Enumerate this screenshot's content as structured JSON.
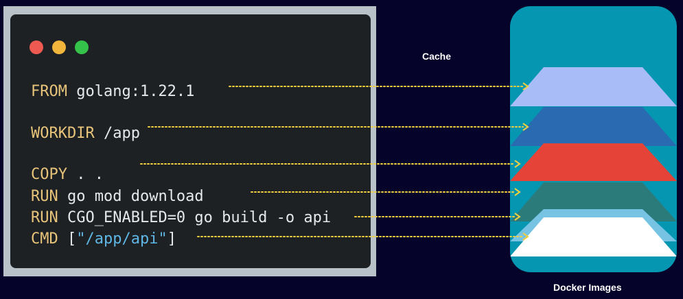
{
  "terminal": {
    "window_dots": [
      {
        "name": "close",
        "color": "#ee5a52"
      },
      {
        "name": "minimize",
        "color": "#f3b63d"
      },
      {
        "name": "maximize",
        "color": "#35c24a"
      }
    ],
    "lines": [
      {
        "keyword": "FROM",
        "text": " golang:1.22.1",
        "string": "",
        "suffix": ""
      },
      {
        "keyword": "WORKDIR",
        "text": " /app",
        "string": "",
        "suffix": ""
      },
      {
        "keyword": "COPY",
        "text": " . .",
        "string": "",
        "suffix": ""
      },
      {
        "keyword": "RUN",
        "text": " go mod download",
        "string": "",
        "suffix": ""
      },
      {
        "keyword": "RUN",
        "text": " CGO_ENABLED=0 go build -o api",
        "string": "",
        "suffix": ""
      },
      {
        "keyword": "CMD",
        "text": " [",
        "string": "\"/app/api\"",
        "suffix": "]"
      }
    ]
  },
  "labels": {
    "cache": "Cache",
    "images": "Docker Images"
  },
  "layer_colors": [
    "#a8bdf8",
    "#2a6ab0",
    "#e54338",
    "#2c7b7b",
    "#76c3e4",
    "#ffffff"
  ],
  "colors": {
    "background": "#05032a",
    "image_container": "#0596b2",
    "connector": "#f4d03f",
    "keyword": "#e8c37a",
    "string": "#5fb7e6"
  }
}
